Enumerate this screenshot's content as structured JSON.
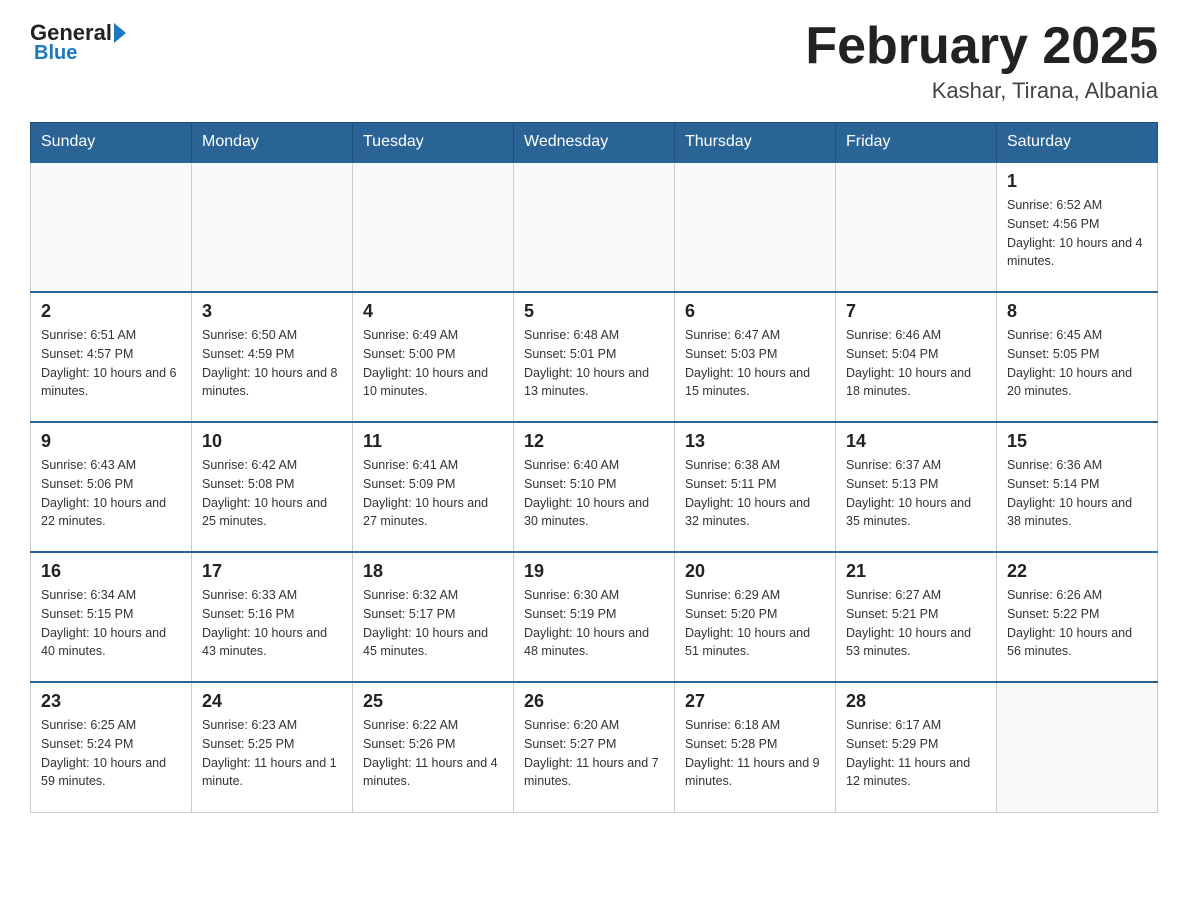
{
  "logo": {
    "general": "General",
    "blue": "Blue"
  },
  "title": "February 2025",
  "location": "Kashar, Tirana, Albania",
  "weekdays": [
    "Sunday",
    "Monday",
    "Tuesday",
    "Wednesday",
    "Thursday",
    "Friday",
    "Saturday"
  ],
  "weeks": [
    [
      {
        "day": "",
        "info": ""
      },
      {
        "day": "",
        "info": ""
      },
      {
        "day": "",
        "info": ""
      },
      {
        "day": "",
        "info": ""
      },
      {
        "day": "",
        "info": ""
      },
      {
        "day": "",
        "info": ""
      },
      {
        "day": "1",
        "info": "Sunrise: 6:52 AM\nSunset: 4:56 PM\nDaylight: 10 hours and 4 minutes."
      }
    ],
    [
      {
        "day": "2",
        "info": "Sunrise: 6:51 AM\nSunset: 4:57 PM\nDaylight: 10 hours and 6 minutes."
      },
      {
        "day": "3",
        "info": "Sunrise: 6:50 AM\nSunset: 4:59 PM\nDaylight: 10 hours and 8 minutes."
      },
      {
        "day": "4",
        "info": "Sunrise: 6:49 AM\nSunset: 5:00 PM\nDaylight: 10 hours and 10 minutes."
      },
      {
        "day": "5",
        "info": "Sunrise: 6:48 AM\nSunset: 5:01 PM\nDaylight: 10 hours and 13 minutes."
      },
      {
        "day": "6",
        "info": "Sunrise: 6:47 AM\nSunset: 5:03 PM\nDaylight: 10 hours and 15 minutes."
      },
      {
        "day": "7",
        "info": "Sunrise: 6:46 AM\nSunset: 5:04 PM\nDaylight: 10 hours and 18 minutes."
      },
      {
        "day": "8",
        "info": "Sunrise: 6:45 AM\nSunset: 5:05 PM\nDaylight: 10 hours and 20 minutes."
      }
    ],
    [
      {
        "day": "9",
        "info": "Sunrise: 6:43 AM\nSunset: 5:06 PM\nDaylight: 10 hours and 22 minutes."
      },
      {
        "day": "10",
        "info": "Sunrise: 6:42 AM\nSunset: 5:08 PM\nDaylight: 10 hours and 25 minutes."
      },
      {
        "day": "11",
        "info": "Sunrise: 6:41 AM\nSunset: 5:09 PM\nDaylight: 10 hours and 27 minutes."
      },
      {
        "day": "12",
        "info": "Sunrise: 6:40 AM\nSunset: 5:10 PM\nDaylight: 10 hours and 30 minutes."
      },
      {
        "day": "13",
        "info": "Sunrise: 6:38 AM\nSunset: 5:11 PM\nDaylight: 10 hours and 32 minutes."
      },
      {
        "day": "14",
        "info": "Sunrise: 6:37 AM\nSunset: 5:13 PM\nDaylight: 10 hours and 35 minutes."
      },
      {
        "day": "15",
        "info": "Sunrise: 6:36 AM\nSunset: 5:14 PM\nDaylight: 10 hours and 38 minutes."
      }
    ],
    [
      {
        "day": "16",
        "info": "Sunrise: 6:34 AM\nSunset: 5:15 PM\nDaylight: 10 hours and 40 minutes."
      },
      {
        "day": "17",
        "info": "Sunrise: 6:33 AM\nSunset: 5:16 PM\nDaylight: 10 hours and 43 minutes."
      },
      {
        "day": "18",
        "info": "Sunrise: 6:32 AM\nSunset: 5:17 PM\nDaylight: 10 hours and 45 minutes."
      },
      {
        "day": "19",
        "info": "Sunrise: 6:30 AM\nSunset: 5:19 PM\nDaylight: 10 hours and 48 minutes."
      },
      {
        "day": "20",
        "info": "Sunrise: 6:29 AM\nSunset: 5:20 PM\nDaylight: 10 hours and 51 minutes."
      },
      {
        "day": "21",
        "info": "Sunrise: 6:27 AM\nSunset: 5:21 PM\nDaylight: 10 hours and 53 minutes."
      },
      {
        "day": "22",
        "info": "Sunrise: 6:26 AM\nSunset: 5:22 PM\nDaylight: 10 hours and 56 minutes."
      }
    ],
    [
      {
        "day": "23",
        "info": "Sunrise: 6:25 AM\nSunset: 5:24 PM\nDaylight: 10 hours and 59 minutes."
      },
      {
        "day": "24",
        "info": "Sunrise: 6:23 AM\nSunset: 5:25 PM\nDaylight: 11 hours and 1 minute."
      },
      {
        "day": "25",
        "info": "Sunrise: 6:22 AM\nSunset: 5:26 PM\nDaylight: 11 hours and 4 minutes."
      },
      {
        "day": "26",
        "info": "Sunrise: 6:20 AM\nSunset: 5:27 PM\nDaylight: 11 hours and 7 minutes."
      },
      {
        "day": "27",
        "info": "Sunrise: 6:18 AM\nSunset: 5:28 PM\nDaylight: 11 hours and 9 minutes."
      },
      {
        "day": "28",
        "info": "Sunrise: 6:17 AM\nSunset: 5:29 PM\nDaylight: 11 hours and 12 minutes."
      },
      {
        "day": "",
        "info": ""
      }
    ]
  ]
}
